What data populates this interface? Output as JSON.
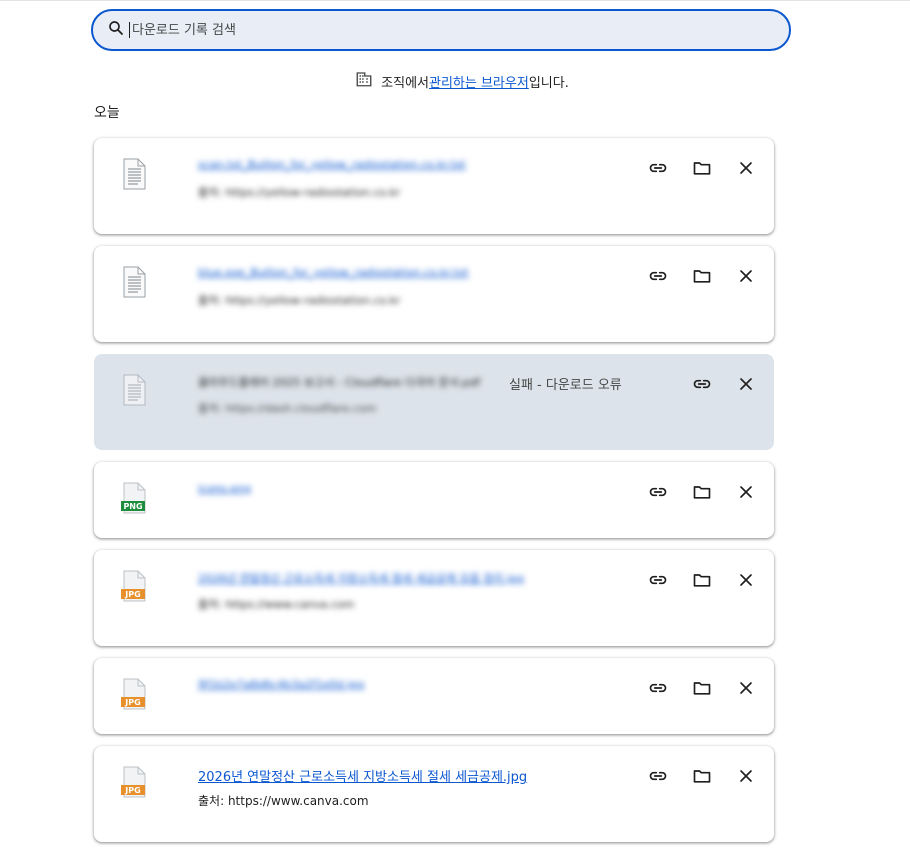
{
  "search": {
    "placeholder": "다운로드 기록 검색"
  },
  "managed": {
    "prefix": "조직에서 ",
    "link": "관리하는 브라우저",
    "suffix": "입니다."
  },
  "date_header": "오늘",
  "downloads": [
    {
      "name": "scan.txt_Bullion_for_yellow_radiostation.co.kr.txt",
      "source": "출처: https://yellow-radiostation.co.kr",
      "icon": "text-file-icon",
      "status": "",
      "blurred": true
    },
    {
      "name": "blue.exe_Bullion_for_yellow_radiostation.co.kr.txt",
      "source": "출처: https://yellow-radiostation.co.kr",
      "icon": "text-file-icon",
      "status": "",
      "blurred": true
    },
    {
      "name": "클라우드플레어 2025 보고서 - Cloudflare 다국어 문서.pdf",
      "source": "출처: https://dash.cloudflare.com",
      "icon": "text-file-icon",
      "status": "실패 - 다운로드 오류",
      "blurred": true,
      "failed": true
    },
    {
      "name": "icons.png",
      "source": "",
      "icon": "png-file-icon",
      "status": "",
      "blurred": true
    },
    {
      "name": "2026년 연말정산 근로소득세 지방소득세 절세 세금공제 모음 정리.jpg",
      "source": "출처: https://www.canva.com",
      "icon": "jpg-file-icon",
      "status": "",
      "blurred": true
    },
    {
      "name": "9f1b2e7a8d6c4b3a2f1e0d.jpg",
      "source": "",
      "icon": "jpg-file-icon",
      "status": "",
      "blurred": true
    },
    {
      "name": "2026년 연말정산 근로소득세 지방소득세 절세 세금공제.jpg",
      "source": "출처: https://www.canva.com",
      "icon": "jpg-file-icon",
      "status": "",
      "blurred": false
    }
  ],
  "colors": {
    "accent": "#0b57d0",
    "failed_bg": "#dde3ea",
    "search_bg": "#e9eef6",
    "png_badge": "#1e8e3e",
    "jpg_badge": "#e8912c"
  }
}
